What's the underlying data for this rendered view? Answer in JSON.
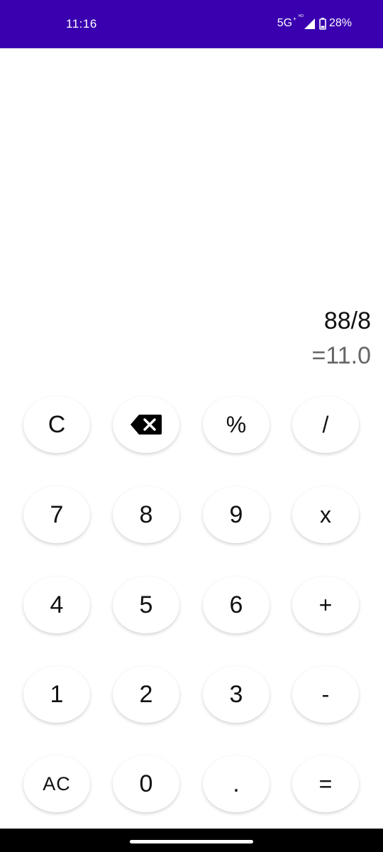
{
  "status_bar": {
    "time": "11:16",
    "network": "5G",
    "network_sup": "+",
    "hd_label": "HD",
    "battery_percent": "28%",
    "bg_color": "#3a00b0"
  },
  "display": {
    "expression": "88/8",
    "result": "=11.0"
  },
  "keypad": {
    "row1": {
      "clear": "C",
      "backspace_icon": "backspace-icon",
      "percent": "%",
      "divide": "/"
    },
    "row2": {
      "seven": "7",
      "eight": "8",
      "nine": "9",
      "multiply": "x"
    },
    "row3": {
      "four": "4",
      "five": "5",
      "six": "6",
      "plus": "+"
    },
    "row4": {
      "one": "1",
      "two": "2",
      "three": "3",
      "minus": "-"
    },
    "row5": {
      "all_clear": "AC",
      "zero": "0",
      "decimal": ".",
      "equals": "="
    }
  }
}
